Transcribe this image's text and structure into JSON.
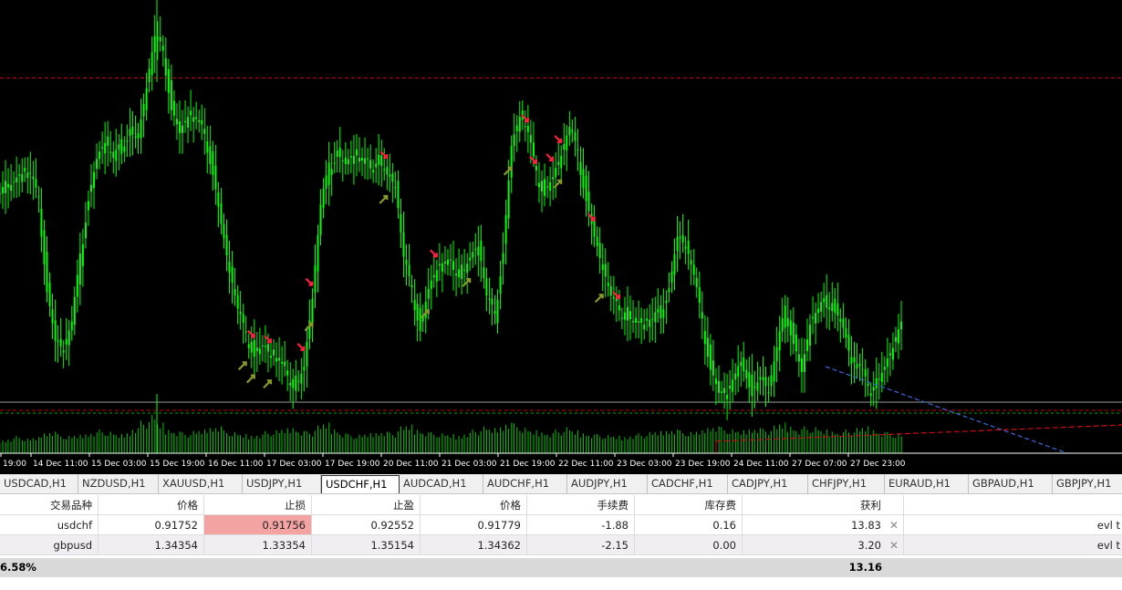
{
  "chart": {
    "background": "#000000",
    "bull_color": "#00ff00",
    "bear_color": "#00ff00",
    "volume_color": "#00c800",
    "x_labels": [
      "19:00",
      "14 Dec 11:00",
      "15 Dec 03:00",
      "15 Dec 19:00",
      "16 Dec 11:00",
      "17 Dec 03:00",
      "17 Dec 19:00",
      "20 Dec 11:00",
      "21 Dec 03:00",
      "21 Dec 19:00",
      "22 Dec 11:00",
      "23 Dec 03:00",
      "23 Dec 19:00",
      "24 Dec 11:00",
      "27 Dec 07:00",
      "27 Dec 23:00"
    ],
    "closes": [
      0.9228,
      0.9231,
      0.9233,
      0.9232,
      0.9222,
      0.919,
      0.917,
      0.9165,
      0.9175,
      0.92,
      0.9225,
      0.924,
      0.9245,
      0.9238,
      0.9244,
      0.925,
      0.9248,
      0.9266,
      0.9285,
      0.928,
      0.926,
      0.925,
      0.9255,
      0.9253,
      0.9248,
      0.9235,
      0.9215,
      0.9195,
      0.918,
      0.917,
      0.9165,
      0.9168,
      0.9163,
      0.916,
      0.9155,
      0.9152,
      0.916,
      0.9185,
      0.922,
      0.9235,
      0.9242,
      0.9238,
      0.924,
      0.9237,
      0.9236,
      0.9239,
      0.9234,
      0.9228,
      0.92,
      0.9187,
      0.9175,
      0.919,
      0.9196,
      0.9198,
      0.9197,
      0.9195,
      0.9202,
      0.9205,
      0.9185,
      0.9178,
      0.9205,
      0.9245,
      0.9255,
      0.9248,
      0.9232,
      0.9227,
      0.9233,
      0.924,
      0.925,
      0.924,
      0.9225,
      0.921,
      0.9196,
      0.9185,
      0.918,
      0.9179,
      0.9177,
      0.9175,
      0.9176,
      0.918,
      0.919,
      0.921,
      0.9205,
      0.9193,
      0.9175,
      0.916,
      0.915,
      0.9148,
      0.9155,
      0.916,
      0.915,
      0.9156,
      0.9149,
      0.9165,
      0.918,
      0.917,
      0.9158,
      0.9175,
      0.918,
      0.9184,
      0.9182,
      0.9175,
      0.916,
      0.9158,
      0.915,
      0.9153,
      0.916,
      0.9166,
      0.9175
    ],
    "volumes": [
      0.35,
      0.4,
      0.45,
      0.38,
      0.42,
      0.55,
      0.6,
      0.5,
      0.45,
      0.48,
      0.52,
      0.58,
      0.62,
      0.56,
      0.5,
      0.55,
      0.7,
      0.85,
      1.0,
      0.8,
      0.65,
      0.6,
      0.55,
      0.58,
      0.62,
      0.7,
      0.75,
      0.6,
      0.55,
      0.5,
      0.48,
      0.52,
      0.58,
      0.6,
      0.65,
      0.7,
      0.62,
      0.58,
      0.72,
      0.8,
      0.66,
      0.55,
      0.5,
      0.48,
      0.52,
      0.56,
      0.6,
      0.54,
      0.7,
      0.75,
      0.65,
      0.58,
      0.55,
      0.52,
      0.5,
      0.48,
      0.56,
      0.62,
      0.7,
      0.66,
      0.72,
      0.85,
      0.78,
      0.66,
      0.6,
      0.58,
      0.56,
      0.62,
      0.68,
      0.6,
      0.55,
      0.52,
      0.5,
      0.48,
      0.46,
      0.45,
      0.5,
      0.52,
      0.55,
      0.58,
      0.62,
      0.66,
      0.6,
      0.55,
      0.6,
      0.7,
      0.75,
      0.68,
      0.62,
      0.6,
      0.66,
      0.7,
      0.64,
      0.72,
      0.8,
      0.74,
      0.66,
      0.7,
      0.68,
      0.62,
      0.6,
      0.58,
      0.62,
      0.66,
      0.7,
      0.64,
      0.58,
      0.55,
      0.5
    ],
    "y_range": [
      0.9135,
      0.93
    ],
    "resistance_level": 0.927,
    "current_price": 0.91779,
    "stop_level": 0.91756,
    "buy_arrows": [
      29,
      30,
      32,
      37,
      46,
      51,
      56,
      61,
      67,
      72
    ],
    "sell_arrows": [
      30,
      32,
      36,
      37,
      46,
      52,
      63,
      64,
      66,
      67,
      71,
      74
    ],
    "trend_blue": {
      "from_index": 92,
      "to_index": 106
    },
    "tabs": [
      "USDCAD,H1",
      "NZDUSD,H1",
      "XAUUSD,H1",
      "USDJPY,H1",
      "USDCHF,H1",
      "AUDCAD,H1",
      "AUDCHF,H1",
      "AUDJPY,H1",
      "CADCHF,H1",
      "CADJPY,H1",
      "CHFJPY,H1",
      "EURAUD,H1",
      "GBPAUD,H1",
      "GBPJPY,H1"
    ],
    "active_tab": 4
  },
  "table": {
    "headers": [
      "交易品种",
      "价格",
      "止损",
      "止盈",
      "价格",
      "手续费",
      "库存费",
      "获利"
    ],
    "rows": [
      {
        "symbol": "usdchf",
        "price_open": "0.91752",
        "stop_loss": "0.91756",
        "take_profit": "0.92552",
        "price_current": "0.91779",
        "commission": "-1.88",
        "swap": "0.16",
        "profit": "13.83",
        "note": "evl t"
      },
      {
        "symbol": "gbpusd",
        "price_open": "1.34354",
        "stop_loss": "1.33354",
        "take_profit": "1.35154",
        "price_current": "1.34362",
        "commission": "-2.15",
        "swap": "0.00",
        "profit": "3.20",
        "note": "evl t"
      }
    ],
    "summary_left": "6.58%",
    "summary_total": "13.16"
  }
}
